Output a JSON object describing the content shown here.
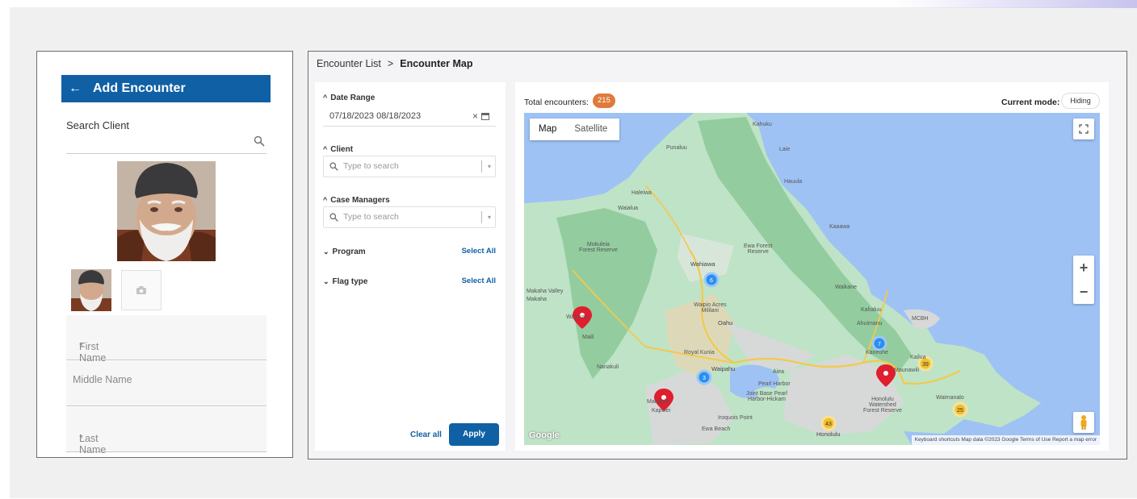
{
  "add_encounter": {
    "title": "Add Encounter",
    "search_label": "Search Client",
    "fields": {
      "first_name": "First Name",
      "middle_name": "Middle Name",
      "last_name": "Last Name"
    },
    "required_mark": "*"
  },
  "breadcrumb": {
    "parent": "Encounter List",
    "separator": ">",
    "current": "Encounter Map"
  },
  "filters": {
    "date_range": {
      "label": "Date Range",
      "value": "07/18/2023  08/18/2023"
    },
    "client": {
      "label": "Client",
      "placeholder": "Type to search"
    },
    "case_managers": {
      "label": "Case Managers",
      "placeholder": "Type to search"
    },
    "program": {
      "label": "Program",
      "select_all": "Select All"
    },
    "flag_type": {
      "label": "Flag type",
      "select_all": "Select All"
    },
    "clear_all": "Clear all",
    "apply": "Apply"
  },
  "map": {
    "total_label": "Total encounters:",
    "total_count": "215",
    "mode_label": "Current mode:",
    "mode_value": "Hiding",
    "tabs": {
      "map": "Map",
      "satellite": "Satellite"
    },
    "zoom_in": "+",
    "zoom_out": "−",
    "google": "Google",
    "footer": "Keyboard shortcuts   Map data ©2023 Google   Terms of Use   Report a map error",
    "places": {
      "kahuku": "Kahuku",
      "laie": "Laie",
      "punaluu": "Punaluu",
      "hauula": "Hauula",
      "haleiwa": "Haleiwa",
      "waialua": "Waialua",
      "kaaawa": "Kaaawa",
      "mokuleia": "Mokuleia\nForest Reserve",
      "ewa_forest": "Ewa Forest\nReserve",
      "wahiawa": "Wahiawa",
      "makaha_valley": "Makaha Valley",
      "makaha": "Makaha",
      "waianae": "Waianae",
      "maili": "Maili",
      "nanakuli": "Nanakuli",
      "mililani": "Waipio Acres\nMililani",
      "oahu": "Oahu",
      "royal_kunia": "Royal Kunia",
      "waipahu": "Waipahu",
      "aiea": "Aiea",
      "pearl_harbor": "Pearl Harbor",
      "jb_pearl": "Joint Base Pearl\nHarbor-Hickam",
      "makakilo": "Makakilo",
      "kapolei": "Kapolei",
      "iroquois": "Iroquois Point",
      "ewa_beach": "Ewa Beach",
      "honolulu": "Honolulu",
      "kaneohe": "Kaneohe",
      "kailua": "Kailua",
      "waikane": "Waikane",
      "kahaluu": "Kahaluu",
      "ahuimanu": "Ahuimanu",
      "mcbh": "MCBH",
      "maunawili": "Maunawili",
      "waimanalo": "Waimanalo",
      "honolulu_watershed": "Honolulu\nWatershed\nForest Reserve"
    }
  },
  "clusters": [
    {
      "count": "6",
      "color": "#2a8ff0"
    },
    {
      "count": "7",
      "color": "#2a8ff0"
    },
    {
      "count": "3",
      "color": "#2a8ff0"
    },
    {
      "count": "39",
      "color": "#f2c12e"
    },
    {
      "count": "25",
      "color": "#f2c12e"
    },
    {
      "count": "43",
      "color": "#f2c12e"
    }
  ],
  "colors": {
    "primary": "#1060a5",
    "badge": "#e07a3a",
    "pin_red": "#e01e2d",
    "water": "#9fc2f4",
    "land": "#bfe3c6",
    "forest": "#94cfa0"
  }
}
